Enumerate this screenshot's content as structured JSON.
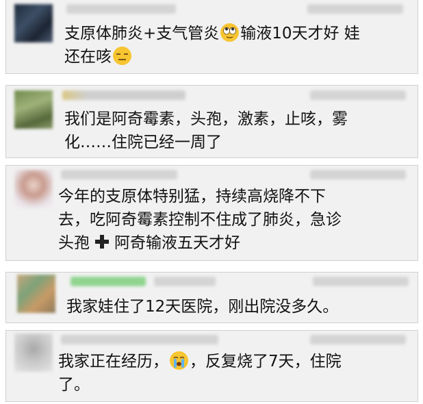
{
  "comments": [
    {
      "text_line1_before": "支原体肺炎+支气管炎",
      "text_line1_after": "输液10天才好 娃",
      "text_line2_before": "还在咳",
      "icon_1": "rolling-eyes-emoji",
      "icon_2": "expressionless-emoji"
    },
    {
      "text_line1": "我们是阿奇霉素，头孢，激素，止咳，雾",
      "text_line2": "化……住院已经一周了"
    },
    {
      "text_line1": "今年的支原体特别猛，持续高烧降不下",
      "text_line2": "去，吃阿奇霉素控制不住成了肺炎，急诊",
      "text_line3_before": "头孢",
      "text_line3_after": "阿奇输液五天才好",
      "icon_1": "plus-icon"
    },
    {
      "text_line1": "我家娃住了12天医院，刚出院没多久。"
    },
    {
      "text_line1_before": "我家正在经历，",
      "text_line1_after": "，反复烧了7天，住院",
      "text_line2": "了。",
      "icon_1": "crying-emoji"
    }
  ],
  "colors": {
    "card_bg": "#f1f1f1",
    "card_border": "#cfcfcf",
    "text": "#111111",
    "emoji_yellow": "#f7c531"
  }
}
